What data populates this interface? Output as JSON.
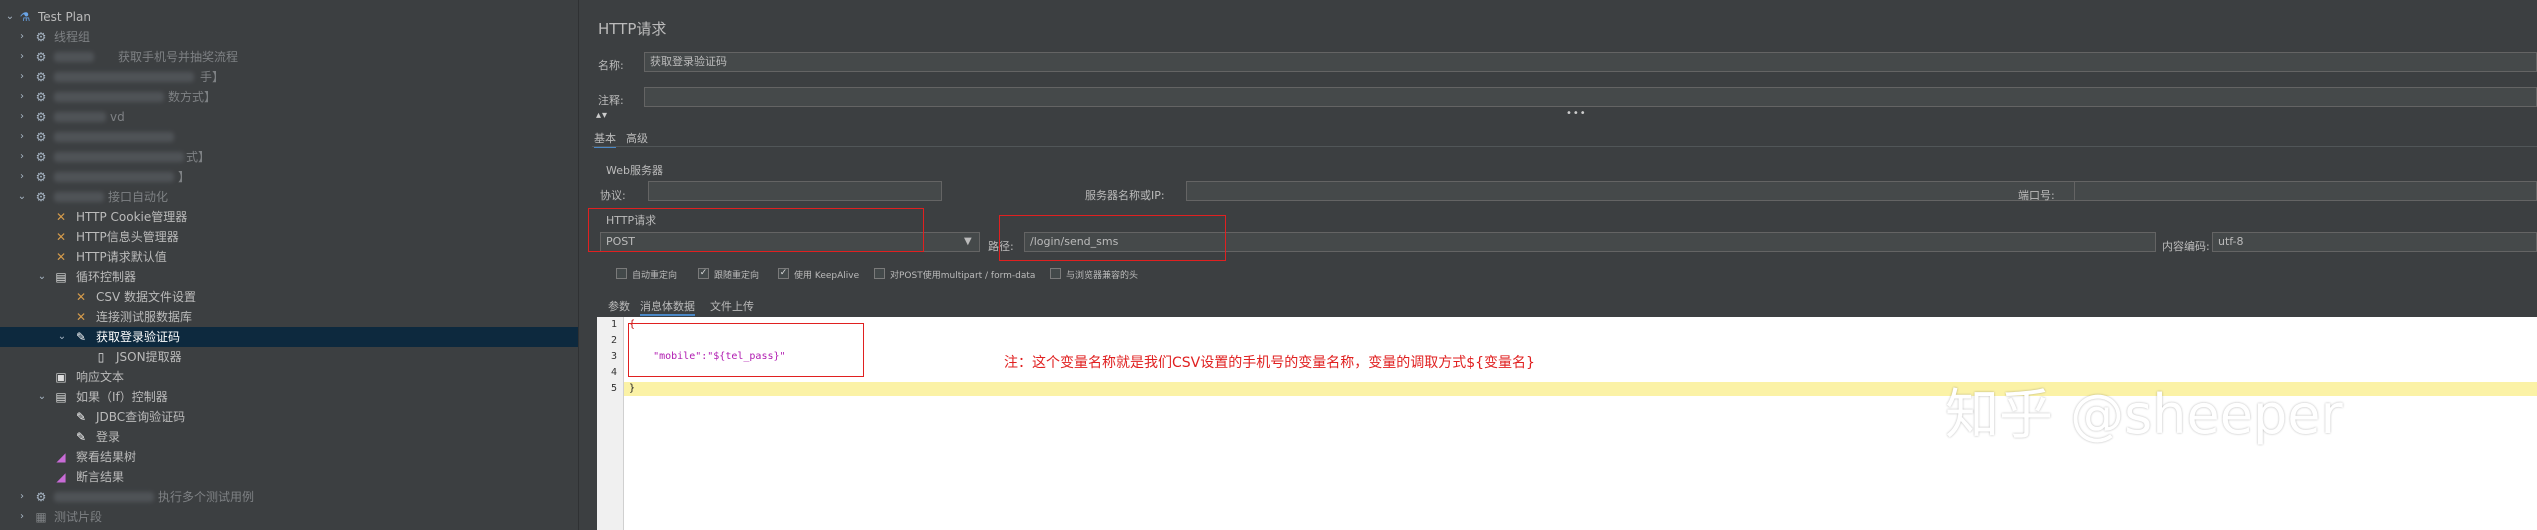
{
  "tree": {
    "root": "Test Plan",
    "items": [
      {
        "label": "线程组"
      },
      {
        "label": "获取手机号并抽奖流程"
      },
      {
        "label": "手】"
      },
      {
        "label": "数方式】"
      },
      {
        "label": "vd"
      },
      {
        "label": ""
      },
      {
        "label": "式】"
      },
      {
        "label": "】"
      },
      {
        "label": "接口自动化"
      },
      {
        "label": "HTTP Cookie管理器"
      },
      {
        "label": "HTTP信息头管理器"
      },
      {
        "label": "HTTP请求默认值"
      },
      {
        "label": "循环控制器"
      },
      {
        "label": "CSV 数据文件设置"
      },
      {
        "label": "连接测试服数据库"
      },
      {
        "label": "获取登录验证码"
      },
      {
        "label": "JSON提取器"
      },
      {
        "label": "响应文本"
      },
      {
        "label": "如果（If）控制器"
      },
      {
        "label": "JDBC查询验证码"
      },
      {
        "label": "登录"
      },
      {
        "label": "察看结果树"
      },
      {
        "label": "断言结果"
      },
      {
        "label": "执行多个测试用例"
      },
      {
        "label": "测试片段"
      }
    ]
  },
  "panel": {
    "title": "HTTP请求",
    "name_label": "名称:",
    "name_value": "获取登录验证码",
    "comment_label": "注释:",
    "comment_value": "",
    "tabs": [
      "基本",
      "高级"
    ],
    "web_server_label": "Web服务器",
    "protocol_label": "协议:",
    "protocol_value": "",
    "server_label": "服务器名称或IP:",
    "server_value": "",
    "port_label": "端口号:",
    "port_value": "",
    "http_request_label": "HTTP请求",
    "method_value": "POST",
    "path_label": "路径:",
    "path_value": "/login/send_sms",
    "encoding_label": "内容编码:",
    "encoding_value": "utf-8",
    "checkboxes": [
      {
        "label": "自动重定向",
        "checked": false
      },
      {
        "label": "跟随重定向",
        "checked": true
      },
      {
        "label": "使用 KeepAlive",
        "checked": true
      },
      {
        "label": "对POST使用multipart / form-data",
        "checked": false
      },
      {
        "label": "与浏览器兼容的头",
        "checked": false
      }
    ],
    "body_tabs": [
      "参数",
      "消息体数据",
      "文件上传"
    ],
    "editor_lines": [
      {
        "num": "1",
        "text": "{"
      },
      {
        "num": "2",
        "text": ""
      },
      {
        "num": "3",
        "text": "    \"mobile\":\"${tel_pass}\""
      },
      {
        "num": "4",
        "text": ""
      },
      {
        "num": "5",
        "text": "}"
      }
    ]
  },
  "annotation": "注：这个变量名称就是我们CSV设置的手机号的变量名称，变量的调取方式${变量名}",
  "watermark": "知乎 @sheeper"
}
